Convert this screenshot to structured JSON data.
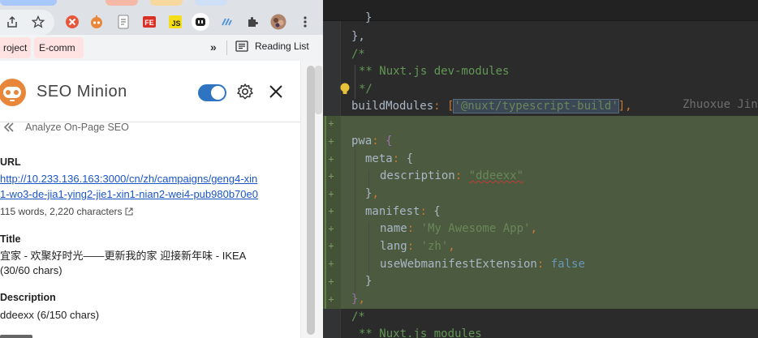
{
  "browser": {
    "bookmarks": {
      "item_project": "roject",
      "item_ecomm": "E-comm",
      "chevron": "»",
      "reading_list": "Reading List"
    }
  },
  "extension": {
    "title": "SEO Minion",
    "back_label": "Analyze On-Page SEO",
    "toggle_on": true,
    "url": {
      "label": "URL",
      "line1": "http://10.233.136.163:3000/cn/zh/campaigns/geng4-xin",
      "line2": "1-wo3-de-jia1-ying2-jie1-xin1-nian2-wei4-pub980b70e0",
      "stats": "115 words, 2,220 characters"
    },
    "title_field": {
      "label": "Title",
      "value": "宜家 - 欢聚好时光——更新我的家 迎接新年味 - IKEA",
      "count": "(30/60 chars)"
    },
    "description": {
      "label": "Description",
      "value": "ddeexx (6/150 chars)"
    }
  },
  "editor": {
    "blame_author": "Zhuoxue Jin",
    "lines": {
      "brace_close_top": "},",
      "comment_open": "/*",
      "comment_devmodules": "** Nuxt.js dev-modules",
      "comment_close": "*/",
      "build_modules_key": "buildModules",
      "build_modules_value": "'@nuxt/typescript-build'",
      "pwa_key": "pwa",
      "meta_key": "meta",
      "description_key": "description",
      "description_value": "\"ddeexx\"",
      "manifest_key": "manifest",
      "name_key": "name",
      "name_value": "'My Awesome App'",
      "lang_key": "lang",
      "lang_value": "'zh'",
      "uwe_key": "useWebmanifestExtension",
      "uwe_value": "false",
      "comment_modules": "** Nuxt.js modules"
    }
  },
  "colors": {
    "accent_orange": "#e8873a",
    "toggle_blue": "#2f74c0",
    "link_blue": "#1a55c8",
    "editor_bg": "#2b2b2b",
    "highlight_bg": "#4c5a3f"
  }
}
